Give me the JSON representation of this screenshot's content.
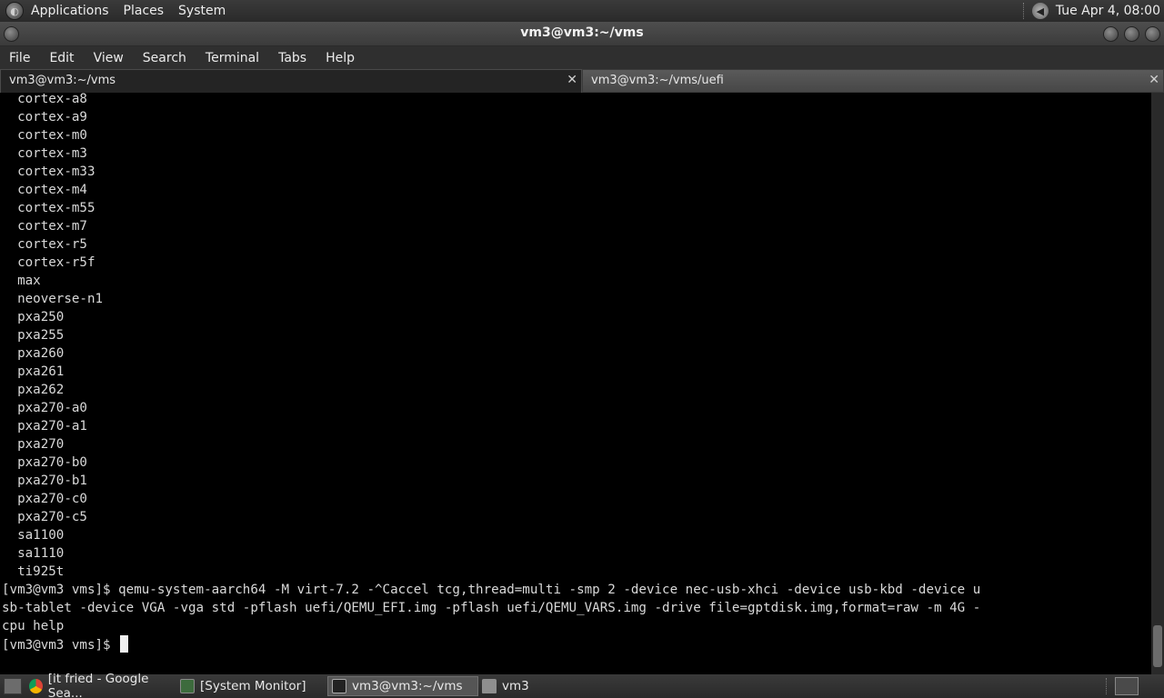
{
  "top_panel": {
    "menus": [
      "Applications",
      "Places",
      "System"
    ],
    "clock": "Tue Apr  4, 08:00"
  },
  "window": {
    "title": "vm3@vm3:~/vms"
  },
  "menubar": {
    "items": [
      "File",
      "Edit",
      "View",
      "Search",
      "Terminal",
      "Tabs",
      "Help"
    ]
  },
  "tabs": [
    {
      "label": "vm3@vm3:~/vms"
    },
    {
      "label": "vm3@vm3:~/vms/uefi"
    }
  ],
  "terminal": {
    "lines": [
      "  cortex-a8",
      "  cortex-a9",
      "  cortex-m0",
      "  cortex-m3",
      "  cortex-m33",
      "  cortex-m4",
      "  cortex-m55",
      "  cortex-m7",
      "  cortex-r5",
      "  cortex-r5f",
      "  max",
      "  neoverse-n1",
      "  pxa250",
      "  pxa255",
      "  pxa260",
      "  pxa261",
      "  pxa262",
      "  pxa270-a0",
      "  pxa270-a1",
      "  pxa270",
      "  pxa270-b0",
      "  pxa270-b1",
      "  pxa270-c0",
      "  pxa270-c5",
      "  sa1100",
      "  sa1110",
      "  ti925t",
      "[vm3@vm3 vms]$ qemu-system-aarch64 -M virt-7.2 -^Caccel tcg,thread=multi -smp 2 -device nec-usb-xhci -device usb-kbd -device u",
      "sb-tablet -device VGA -vga std -pflash uefi/QEMU_EFI.img -pflash uefi/QEMU_VARS.img -drive file=gptdisk.img,format=raw -m 4G -",
      "cpu help"
    ],
    "prompt": "[vm3@vm3 vms]$ "
  },
  "taskbar": {
    "items": [
      {
        "label": "[it fried - Google Sea...",
        "icon": "chrome-icon",
        "active": false
      },
      {
        "label": "[System Monitor]",
        "icon": "system-monitor-icon",
        "active": false
      },
      {
        "label": "vm3@vm3:~/vms",
        "icon": "terminal-icon",
        "active": true
      },
      {
        "label": "vm3",
        "icon": "folder-icon",
        "active": false
      }
    ]
  },
  "colors": {
    "terminal_bg": "#000000",
    "terminal_fg": "#d9d9d9",
    "panel_bg": "#2f2f2f"
  }
}
